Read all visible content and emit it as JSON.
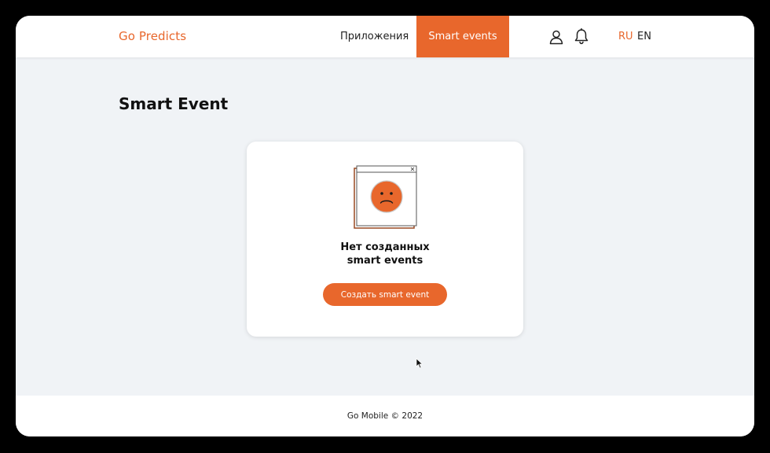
{
  "header": {
    "logo": "Go Predicts",
    "nav": {
      "apps_label": "Приложения",
      "smart_events_label": "Smart events"
    },
    "icons": {
      "user": "user-icon",
      "bell": "bell-icon"
    },
    "languages": {
      "ru": "RU",
      "en": "EN",
      "active": "RU"
    }
  },
  "main": {
    "title": "Smart Event",
    "empty_state": {
      "line1": "Нет созданных",
      "line2": "smart events",
      "button_label": "Создать smart event",
      "illustration": "sad-face-window-icon"
    }
  },
  "footer": {
    "text": "Go Mobile © 2022"
  },
  "colors": {
    "accent": "#e8672c",
    "background": "#f0f3f6",
    "surface": "#ffffff",
    "text": "#111111"
  }
}
